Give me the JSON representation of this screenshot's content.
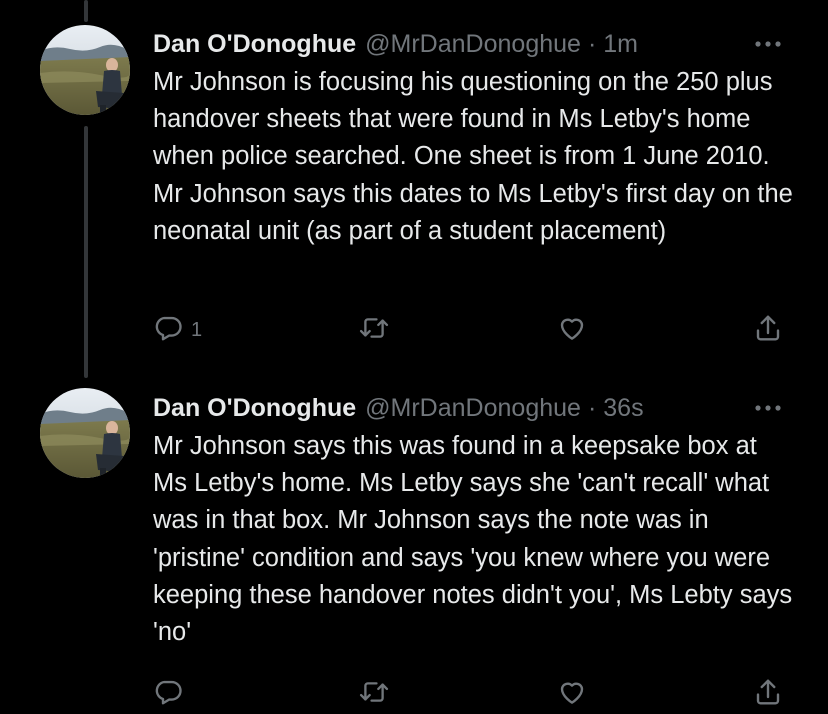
{
  "colors": {
    "background": "#000000",
    "text_primary": "#e7e9ea",
    "text_secondary": "#71767b",
    "thread_line": "#333639"
  },
  "tweets": [
    {
      "author_name": "Dan O'Donoghue",
      "handle": "@MrDanDonoghue",
      "separator": "·",
      "time": "1m",
      "text": "Mr Johnson is focusing his questioning on the 250 plus handover sheets that were found in Ms Letby's home when police searched. One sheet is from 1 June 2010. Mr Johnson says this dates to Ms Letby's first day on the neonatal unit (as part of a student placement)",
      "reply_count": "1",
      "icons": {
        "reply": "reply-icon",
        "retweet": "retweet-icon",
        "like": "heart-icon",
        "share": "share-icon",
        "more": "more-icon"
      }
    },
    {
      "author_name": "Dan O'Donoghue",
      "handle": "@MrDanDonoghue",
      "separator": "·",
      "time": "36s",
      "text": "Mr Johnson says this was found in a keepsake box at Ms Letby's home. Ms Letby says she 'can't recall' what was in that box. Mr Johnson says the note was in 'pristine' condition and says 'you knew where you were keeping these handover notes didn't you', Ms Lebty says 'no'",
      "icons": {
        "reply": "reply-icon",
        "retweet": "retweet-icon",
        "like": "heart-icon",
        "share": "share-icon",
        "more": "more-icon"
      }
    }
  ]
}
